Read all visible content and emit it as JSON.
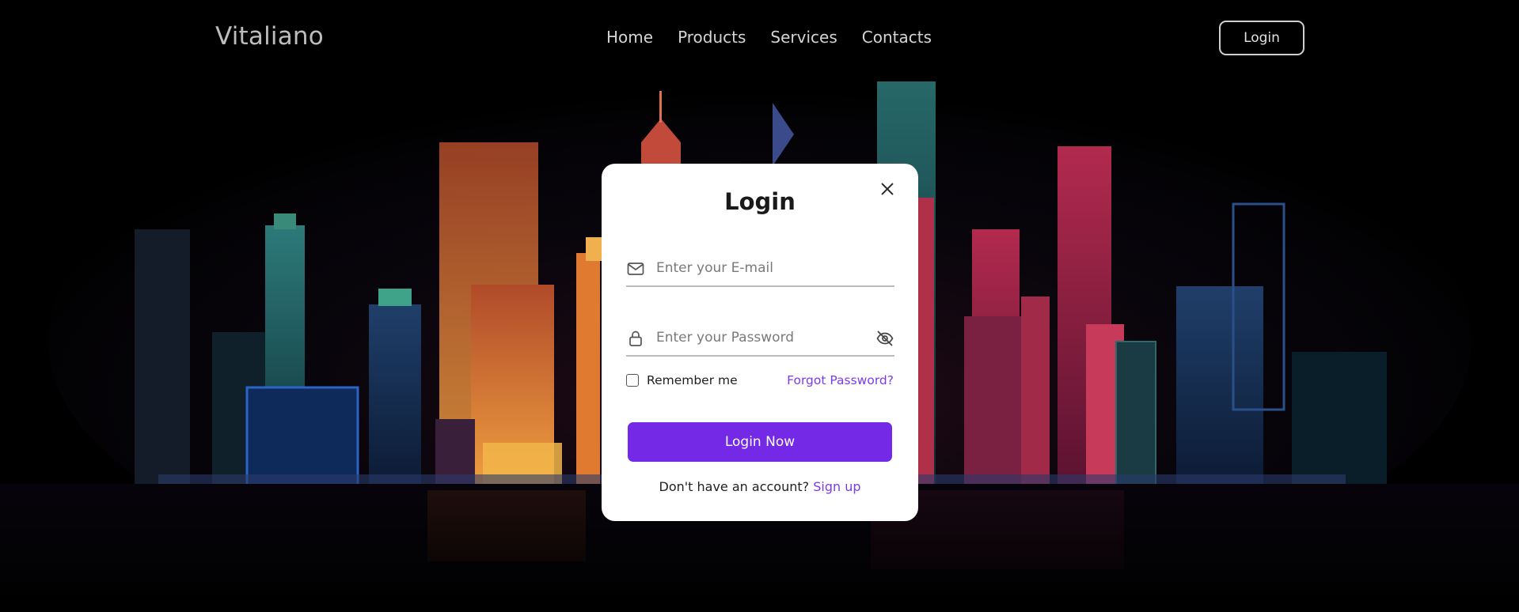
{
  "header": {
    "logo": "Vitaliano",
    "nav": [
      "Home",
      "Products",
      "Services",
      "Contacts"
    ],
    "login_button": "Login"
  },
  "modal": {
    "title": "Login",
    "email_placeholder": "Enter your E-mail",
    "password_placeholder": "Enter your Password",
    "remember_label": "Remember me",
    "forgot_link": "Forgot Password?",
    "submit_label": "Login Now",
    "signup_prompt": "Don't have an account?",
    "signup_link": "Sign up"
  },
  "icons": {
    "close": "close-icon",
    "email": "mail-icon",
    "password": "lock-icon",
    "visibility": "eye-off-icon",
    "checkbox": "checkbox-icon"
  },
  "colors": {
    "accent": "#7429e6",
    "link": "#7a3cf0",
    "background": "#000000"
  }
}
